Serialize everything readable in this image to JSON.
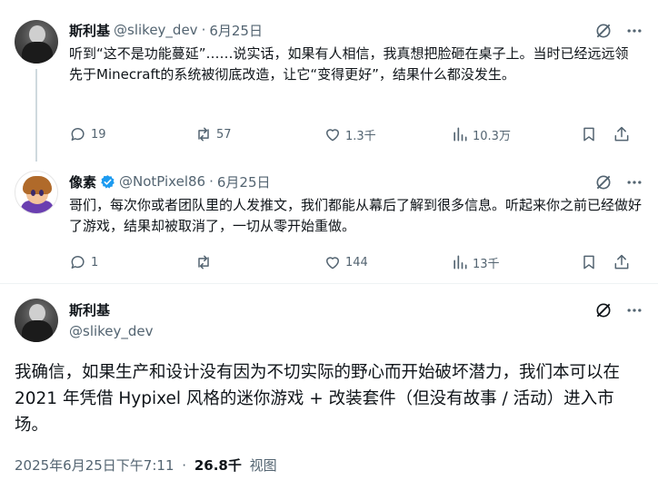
{
  "tweets": [
    {
      "name": "斯利基",
      "handle": "@slikey_dev",
      "date": "6月25日",
      "text": "听到“这不是功能蔓延”……说实话，如果有人相信，我真想把脸砸在桌子上。当时已经远远领先于Minecraft的系统被彻底改造，让它“变得更好”，结果什么都没发生。",
      "replies": "19",
      "reposts": "57",
      "likes": "1.3千",
      "views": "10.3万"
    },
    {
      "name": "像素",
      "handle": "@NotPixel86",
      "date": "6月25日",
      "text": "哥们，每次你或者团队里的人发推文，我们都能从幕后了解到很多信息。听起来你之前已经做好了游戏，结果却被取消了，一切从零开始重做。",
      "replies": "1",
      "reposts": "",
      "likes": "144",
      "views": "13千"
    }
  ],
  "main": {
    "name": "斯利基",
    "handle": "@slikey_dev",
    "text": "我确信，如果生产和设计没有因为不切实际的野心而开始破坏潜力，我们本可以在 2021 年凭借 Hypixel 风格的迷你游戏 + 改装套件（但没有故事 / 活动）进入市场。",
    "timestamp": "2025年6月25日下午7:11",
    "separator": "·",
    "views_count": "26.8千",
    "views_label": "视图"
  },
  "dot": "·",
  "colors": {
    "text": "#0f1419",
    "secondary": "#536471",
    "verified": "#1d9bf0",
    "divider": "#eff3f4"
  },
  "icons": [
    "grok-icon",
    "more-icon",
    "reply-icon",
    "repost-icon",
    "like-icon",
    "views-icon",
    "bookmark-icon",
    "share-icon",
    "verified-badge-icon"
  ]
}
